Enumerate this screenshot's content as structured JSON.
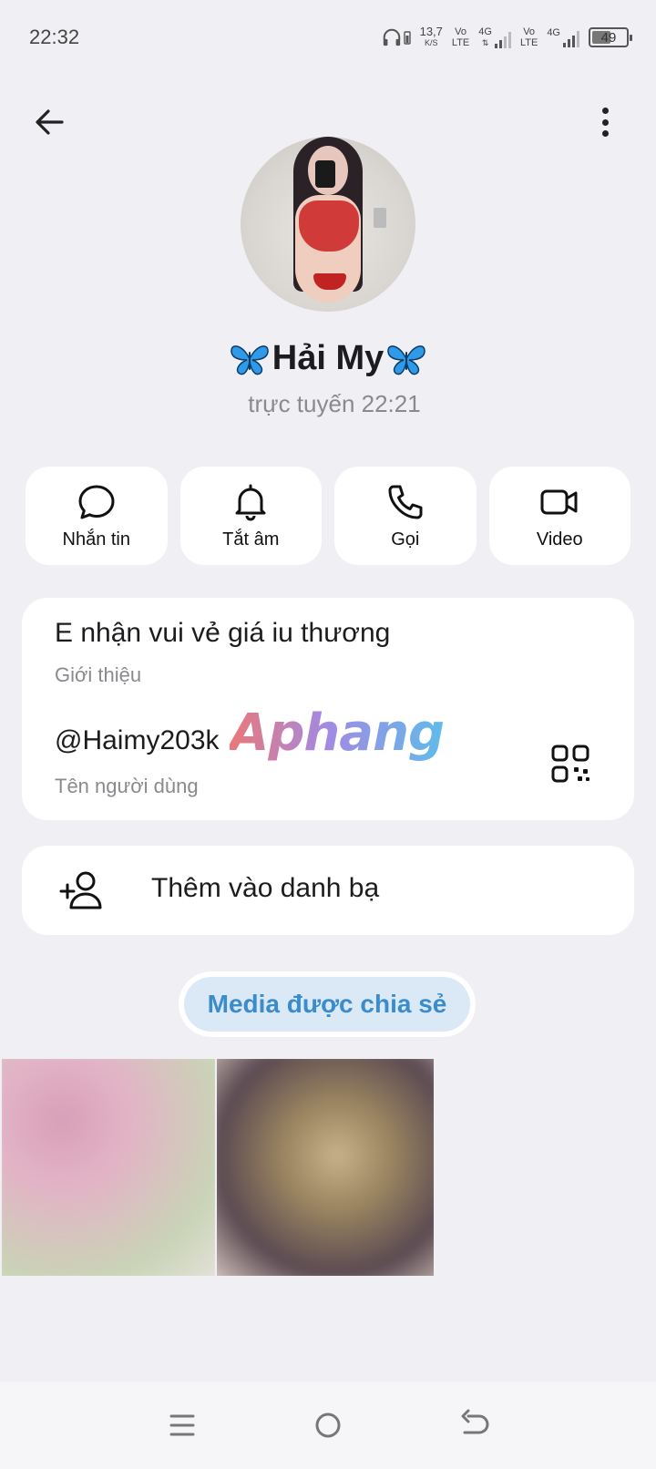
{
  "status_bar": {
    "time": "22:32",
    "speed_value": "13,7",
    "speed_unit": "K/S",
    "sim1_vo": "Vo",
    "sim1_lte": "LTE",
    "sim1_net": "4G",
    "sim2_vo": "Vo",
    "sim2_lte": "LTE",
    "sim2_net": "4G",
    "battery": "49"
  },
  "header": {
    "back_icon": "arrow-left-icon",
    "more_icon": "more-vertical-icon"
  },
  "profile": {
    "name": "Hải My",
    "last_seen": "trực tuyến 22:21",
    "emoji_icon": "butterfly-icon"
  },
  "actions": [
    {
      "label": "Nhắn tin",
      "icon": "message-icon"
    },
    {
      "label": "Tắt âm",
      "icon": "bell-icon"
    },
    {
      "label": "Gọi",
      "icon": "phone-icon"
    },
    {
      "label": "Video",
      "icon": "video-icon"
    }
  ],
  "info": {
    "bio": "E nhận vui vẻ giá iu thương",
    "bio_label": "Giới thiệu",
    "username": "@Haimy203k",
    "username_label": "Tên người dùng",
    "watermark": "Aphang",
    "qr_icon": "qr-code-icon"
  },
  "add_contact": {
    "label": "Thêm vào danh bạ",
    "icon": "add-user-icon"
  },
  "media": {
    "tab_label": "Media được chia sẻ"
  },
  "colors": {
    "background": "#f0f0f4",
    "card": "#ffffff",
    "accent": "#3b8ccb",
    "accent_bg": "#dbe9f6",
    "muted_text": "#8a8a8e"
  }
}
